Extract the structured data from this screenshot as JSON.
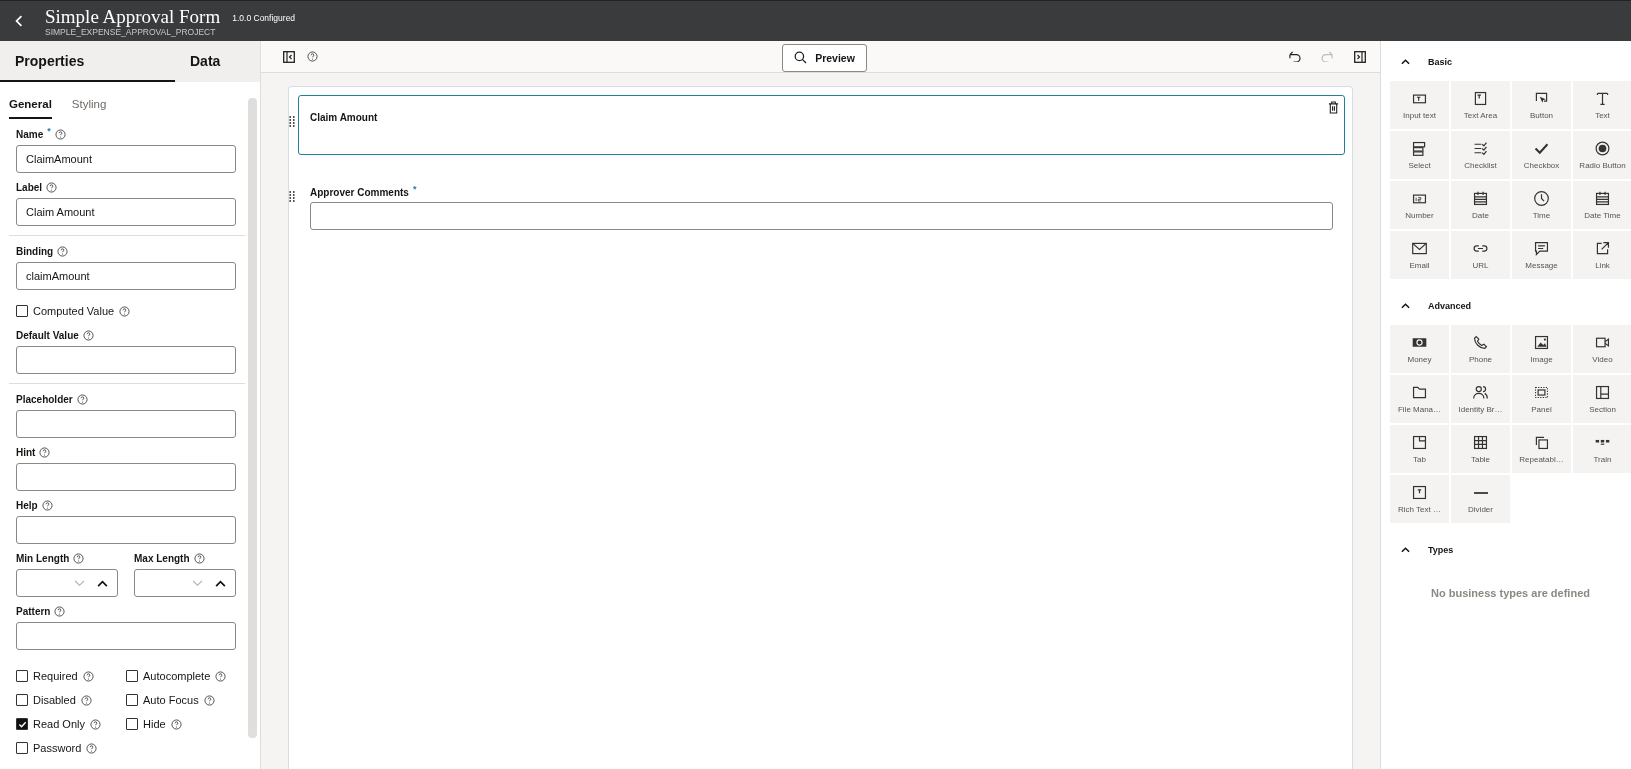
{
  "header": {
    "title": "Simple Approval Form",
    "subtitle": "SIMPLE_EXPENSE_APPROVAL_PROJECT",
    "version": "1.0.0 Configured"
  },
  "left_panel": {
    "tabs": [
      {
        "label": "Properties",
        "selected": true
      },
      {
        "label": "Data",
        "selected": false
      }
    ],
    "subtabs": [
      {
        "label": "General",
        "selected": true
      },
      {
        "label": "Styling",
        "selected": false
      }
    ],
    "groups": [
      [
        {
          "kind": "input",
          "label": "Name",
          "required_mark": "*",
          "value": "ClaimAmount"
        },
        {
          "kind": "input",
          "label": "Label",
          "value": "Claim Amount"
        }
      ],
      [
        {
          "kind": "input",
          "label": "Binding",
          "value": "claimAmount"
        },
        {
          "kind": "checkbox",
          "label": "Computed Value",
          "checked": false
        },
        {
          "kind": "input",
          "label": "Default Value"
        }
      ],
      [
        {
          "kind": "input",
          "label": "Placeholder"
        },
        {
          "kind": "input",
          "label": "Hint"
        },
        {
          "kind": "input",
          "label": "Help"
        },
        {
          "kind": "spinners",
          "fields": [
            {
              "label": "Min Length"
            },
            {
              "label": "Max Length"
            }
          ]
        },
        {
          "kind": "input",
          "label": "Pattern"
        },
        {
          "kind": "checkgrid",
          "items": [
            {
              "label": "Required",
              "checked": false
            },
            {
              "label": "Autocomplete",
              "checked": false
            },
            {
              "label": "Disabled",
              "checked": false
            },
            {
              "label": "Auto Focus",
              "checked": false
            },
            {
              "label": "Read Only",
              "checked": true
            },
            {
              "label": "Hide",
              "checked": false
            },
            {
              "label": "Password",
              "checked": false
            }
          ]
        }
      ]
    ]
  },
  "toolbar": {
    "preview": "Preview",
    "redo_disabled": true
  },
  "form_fields": [
    {
      "kind": "readonly",
      "label": "Claim Amount",
      "selected": true
    },
    {
      "kind": "input",
      "label": "Approver Comments",
      "required_mark": "*",
      "selected": false
    }
  ],
  "palette": [
    {
      "title": "Basic",
      "expanded": true,
      "tiles": [
        "Input text",
        "Text Area",
        "Button",
        "Text",
        "Select",
        "Checklist",
        "Checkbox",
        "Radio Button",
        "Number",
        "Date",
        "Time",
        "Date Time",
        "Email",
        "URL",
        "Message",
        "Link"
      ]
    },
    {
      "title": "Advanced",
      "expanded": true,
      "tiles": [
        "Money",
        "Phone",
        "Image",
        "Video",
        "File Mana…",
        "Identity Br…",
        "Panel",
        "Section",
        "Tab",
        "Table",
        "Repeatabl…",
        "Train",
        "Rich Text …",
        "Divider"
      ]
    },
    {
      "title": "Types",
      "expanded": true,
      "empty_text": "No business types are defined"
    }
  ]
}
